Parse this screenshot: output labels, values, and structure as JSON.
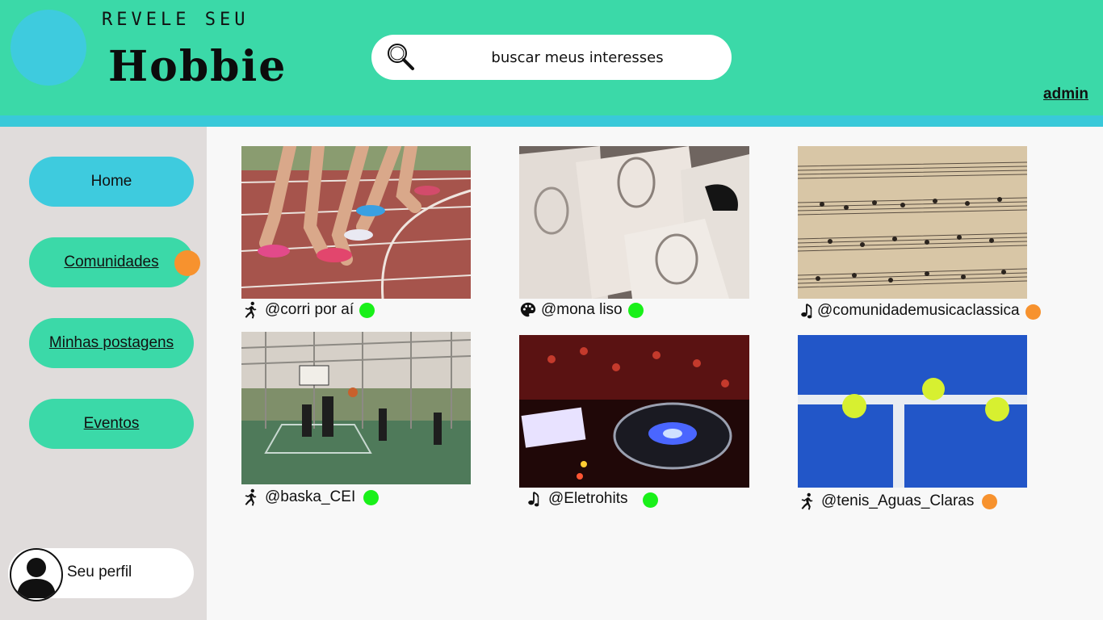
{
  "brand": {
    "tagline": "REVELE SEU",
    "name": "Hobbie"
  },
  "search": {
    "value": "buscar meus interesses",
    "icon": "search-icon"
  },
  "user": {
    "name": "admin"
  },
  "nav": {
    "items": [
      {
        "label": "Home",
        "active": true
      },
      {
        "label": "Comunidades",
        "active": false,
        "notification": true
      },
      {
        "label": "Minhas postagens",
        "active": false
      },
      {
        "label": "Eventos",
        "active": false
      }
    ]
  },
  "profile": {
    "label": "Seu perfil"
  },
  "colors": {
    "header": "#3bd9a8",
    "accent": "#3ecbde",
    "sidebar": "#e0dcdb",
    "online": "#19f019",
    "away": "#f7922e"
  },
  "communities": [
    {
      "handle": "@corri por aí",
      "icon": "running-icon",
      "status": "online",
      "image": "running track with runners' legs"
    },
    {
      "handle": "@mona liso",
      "icon": "palette-icon",
      "status": "online",
      "image": "pencil sketches of sculpted heads"
    },
    {
      "handle": "@comunidademusicaclassica",
      "icon": "music-note-icon",
      "status": "away",
      "image": "sheet music"
    },
    {
      "handle": "@baska_CEI",
      "icon": "running-icon",
      "status": "online",
      "image": "outdoor basketball court players"
    },
    {
      "handle": "@Eletrohits",
      "icon": "music-note-icon",
      "status": "online",
      "image": "DJ turntable with red lights"
    },
    {
      "handle": "@tenis_Aguas_Claras",
      "icon": "running-icon",
      "status": "away",
      "image": "tennis balls on blue court"
    }
  ]
}
